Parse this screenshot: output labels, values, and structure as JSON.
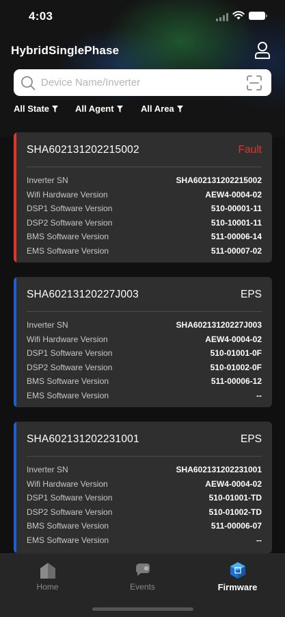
{
  "status_bar": {
    "time": "4:03"
  },
  "header": {
    "title": "HybridSinglePhase",
    "user_icon": "user-icon"
  },
  "search": {
    "placeholder": "Device Name/Inverter",
    "value": "",
    "search_icon": "search-icon",
    "scan_icon": "scan-icon"
  },
  "filters": [
    {
      "label": "All State",
      "icon": "filter-icon"
    },
    {
      "label": "All Agent",
      "icon": "filter-icon"
    },
    {
      "label": "All Area",
      "icon": "filter-icon"
    }
  ],
  "colors": {
    "fault": "#e0342e",
    "eps": "#1e5fd0",
    "accent_active": "#2f8fe0"
  },
  "devices": [
    {
      "sn": "SHA602131202215002",
      "state": "Fault",
      "state_color": "#e0342e",
      "accent_color": "#e0342e",
      "fields": [
        {
          "label": "Inverter SN",
          "value": "SHA602131202215002"
        },
        {
          "label": "Wifi Hardware Version",
          "value": "AEW4-0004-02"
        },
        {
          "label": "DSP1 Software Version",
          "value": "510-00001-11"
        },
        {
          "label": "DSP2 Software Version",
          "value": "510-10001-11"
        },
        {
          "label": "BMS Software Version",
          "value": "511-00006-14"
        },
        {
          "label": "EMS Software Version",
          "value": "511-00007-02"
        }
      ]
    },
    {
      "sn": "SHA60213120227J003",
      "state": "EPS",
      "state_color": "#ffffff",
      "accent_color": "#1e5fd0",
      "fields": [
        {
          "label": "Inverter SN",
          "value": "SHA60213120227J003"
        },
        {
          "label": "Wifi Hardware Version",
          "value": "AEW4-0004-02"
        },
        {
          "label": "DSP1 Software Version",
          "value": "510-01001-0F"
        },
        {
          "label": "DSP2 Software Version",
          "value": "510-01002-0F"
        },
        {
          "label": "BMS Software Version",
          "value": "511-00006-12"
        },
        {
          "label": "EMS Software Version",
          "value": "--"
        }
      ]
    },
    {
      "sn": "SHA602131202231001",
      "state": "EPS",
      "state_color": "#ffffff",
      "accent_color": "#1e5fd0",
      "fields": [
        {
          "label": "Inverter SN",
          "value": "SHA602131202231001"
        },
        {
          "label": "Wifi Hardware Version",
          "value": "AEW4-0004-02"
        },
        {
          "label": "DSP1 Software Version",
          "value": "510-01001-TD"
        },
        {
          "label": "DSP2 Software Version",
          "value": "510-01002-TD"
        },
        {
          "label": "BMS Software Version",
          "value": "511-00006-07"
        },
        {
          "label": "EMS Software Version",
          "value": "--"
        }
      ]
    }
  ],
  "tabs": [
    {
      "label": "Home",
      "icon": "home-icon",
      "active": false
    },
    {
      "label": "Events",
      "icon": "events-icon",
      "active": false
    },
    {
      "label": "Firmware",
      "icon": "firmware-icon",
      "active": true
    }
  ]
}
